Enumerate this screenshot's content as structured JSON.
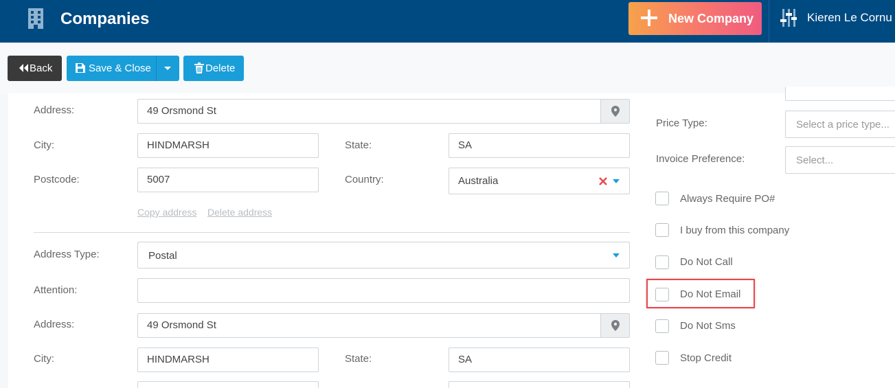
{
  "header": {
    "title": "Companies",
    "new_button_label": "New Company",
    "user_name": "Kieren Le Cornu",
    "icons": {
      "module": "building-icon",
      "new": "plus-icon",
      "settings": "sliders-icon"
    }
  },
  "toolbar": {
    "back_label": "Back",
    "save_close_label": "Save & Close",
    "delete_label": "Delete"
  },
  "address1": {
    "address_label": "Address:",
    "address_value": "49 Orsmond St",
    "city_label": "City:",
    "city_value": "HINDMARSH",
    "state_label": "State:",
    "state_value": "SA",
    "postcode_label": "Postcode:",
    "postcode_value": "5007",
    "country_label": "Country:",
    "country_value": "Australia",
    "copy_link": "Copy address",
    "delete_link": "Delete address"
  },
  "address2": {
    "type_label": "Address Type:",
    "type_value": "Postal",
    "attention_label": "Attention:",
    "attention_value": "",
    "address_label": "Address:",
    "address_value": "49 Orsmond St",
    "city_label": "City:",
    "city_value": "HINDMARSH",
    "state_label": "State:",
    "state_value": "SA"
  },
  "right_panel": {
    "price_type_label": "Price Type:",
    "price_type_placeholder": "Select a price type...",
    "invoice_pref_label": "Invoice Preference:",
    "invoice_pref_placeholder": "Select...",
    "checkboxes": [
      {
        "label": "Always Require PO#",
        "checked": false
      },
      {
        "label": "I buy from this company",
        "checked": false
      },
      {
        "label": "Do Not Call",
        "checked": false
      },
      {
        "label": "Do Not Email",
        "checked": false,
        "highlighted": true
      },
      {
        "label": "Do Not Sms",
        "checked": false
      },
      {
        "label": "Stop Credit",
        "checked": false
      }
    ]
  },
  "colors": {
    "header_bg": "#004a82",
    "accent_blue": "#1a9ed9",
    "back_btn": "#3a3a3a",
    "highlight": "#e5484d"
  }
}
